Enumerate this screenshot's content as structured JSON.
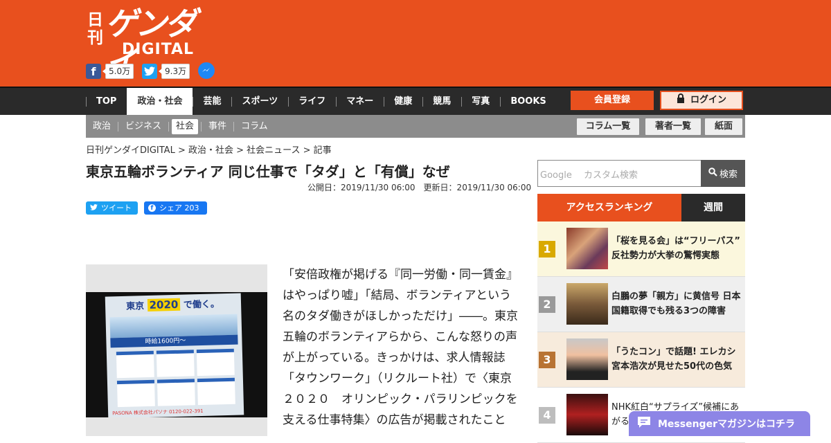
{
  "header": {
    "logo": {
      "nikkan": "日刊",
      "gendai": "ゲンダイ",
      "digital": "DIGITAL"
    },
    "social": {
      "facebook_count": "5.0万",
      "twitter_count": "9.3万"
    },
    "colors": {
      "brand": "#e8501e",
      "facebook": "#3b5998",
      "twitter": "#1da1f2",
      "messenger": "#1e88f5"
    }
  },
  "nav": {
    "items": [
      {
        "label": "TOP"
      },
      {
        "label": "政治・社会"
      },
      {
        "label": "芸能"
      },
      {
        "label": "スポーツ"
      },
      {
        "label": "ライフ"
      },
      {
        "label": "マネー"
      },
      {
        "label": "健康"
      },
      {
        "label": "競馬"
      },
      {
        "label": "写真"
      },
      {
        "label": "BOOKS"
      }
    ],
    "active_index": 1,
    "register_label": "会員登録",
    "login_label": "ログイン"
  },
  "subnav": {
    "items": [
      {
        "label": "政治"
      },
      {
        "label": "ビジネス"
      },
      {
        "label": "社会"
      },
      {
        "label": "事件"
      },
      {
        "label": "コラム"
      }
    ],
    "active_index": 2,
    "buttons": [
      "コラム一覧",
      "著者一覧",
      "紙面"
    ]
  },
  "breadcrumb": "日刊ゲンダイDIGITAL > 政治・社会 > 社会ニュース > 記事",
  "article": {
    "title": "東京五輪ボランティア 同じ仕事で「タダ」と「有償」なぜ",
    "dates": "公開日：2019/11/30 06:00　更新日：2019/11/30 06:00",
    "tweet_label": "ツイート",
    "share_label": "シェア",
    "share_count": "203",
    "photo": {
      "header": "東京",
      "year": "2020",
      "suffix": "で働く。",
      "band": "時給1600円～",
      "footer": "PASONA  株式会社パソナ  0120-022-391"
    },
    "body": "「安倍政権が掲げる『同一労働・同一賃金』はやっぱり嘘」「結局、ボランティアという名のタダ働きがほしかっただけ」――。東京五輪のボランティアらから、こんな怒りの声が上がっている。きっかけは、求人情報誌「タウンワーク」（リクルート社）で〈東京２０２０　オリンピック・パラリンピックを支える仕事特集〉の広告が掲載されたこと"
  },
  "sidebar": {
    "search_placeholder": "Google　 カスタム検索",
    "search_button": "検索",
    "rank_tab_access": "アクセスランキング",
    "rank_tab_weekly": "週間",
    "ranking": [
      {
        "num": "1",
        "title": "「桜を見る会」は“フリーパス” 反社勢力が大挙の驚愕実態",
        "color": "#d9a900",
        "bg": "#fbf7dd"
      },
      {
        "num": "2",
        "title": "白鵬の夢「親方」に黄信号 日本国籍取得でも残る3つの障害",
        "color": "#9a9a9a",
        "bg": "#efefef"
      },
      {
        "num": "3",
        "title": "「うたコン」で話題! エレカシ宮本浩次が見せた50代の色気",
        "color": "#b87333",
        "bg": "#f7ebdc"
      },
      {
        "num": "4",
        "title": "NHK紅白“サプライズ”候補にあがる大",
        "color": "#bdbdbd",
        "bg": "#ffffff"
      }
    ]
  },
  "messenger_bar": "Messengerマガジンはコチラ"
}
